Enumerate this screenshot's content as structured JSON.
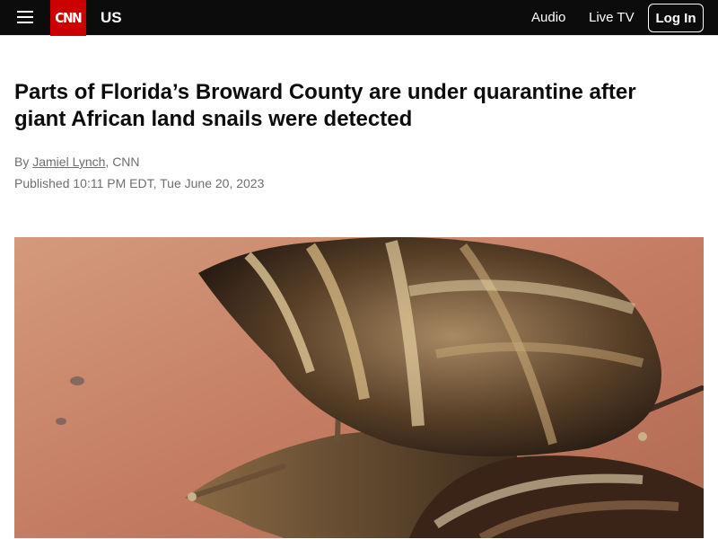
{
  "header": {
    "menu_icon": "hamburger-menu-icon",
    "logo_text": "CNN",
    "section": "US",
    "nav": [
      {
        "label": "Audio"
      },
      {
        "label": "Live TV"
      }
    ],
    "login_label": "Log In"
  },
  "article": {
    "headline": "Parts of Florida’s Broward County are under quarantine after giant African land snails were detected",
    "byline": {
      "prefix": "By ",
      "author": "Jamiel Lynch",
      "suffix": ", CNN"
    },
    "published": "Published 10:11 PM EDT, Tue June 20, 2023"
  },
  "colors": {
    "topbar": "#0c0c0c",
    "brand_red": "#cc0000",
    "headline": "#0c0c0c",
    "meta_text": "#6e6e6e"
  }
}
